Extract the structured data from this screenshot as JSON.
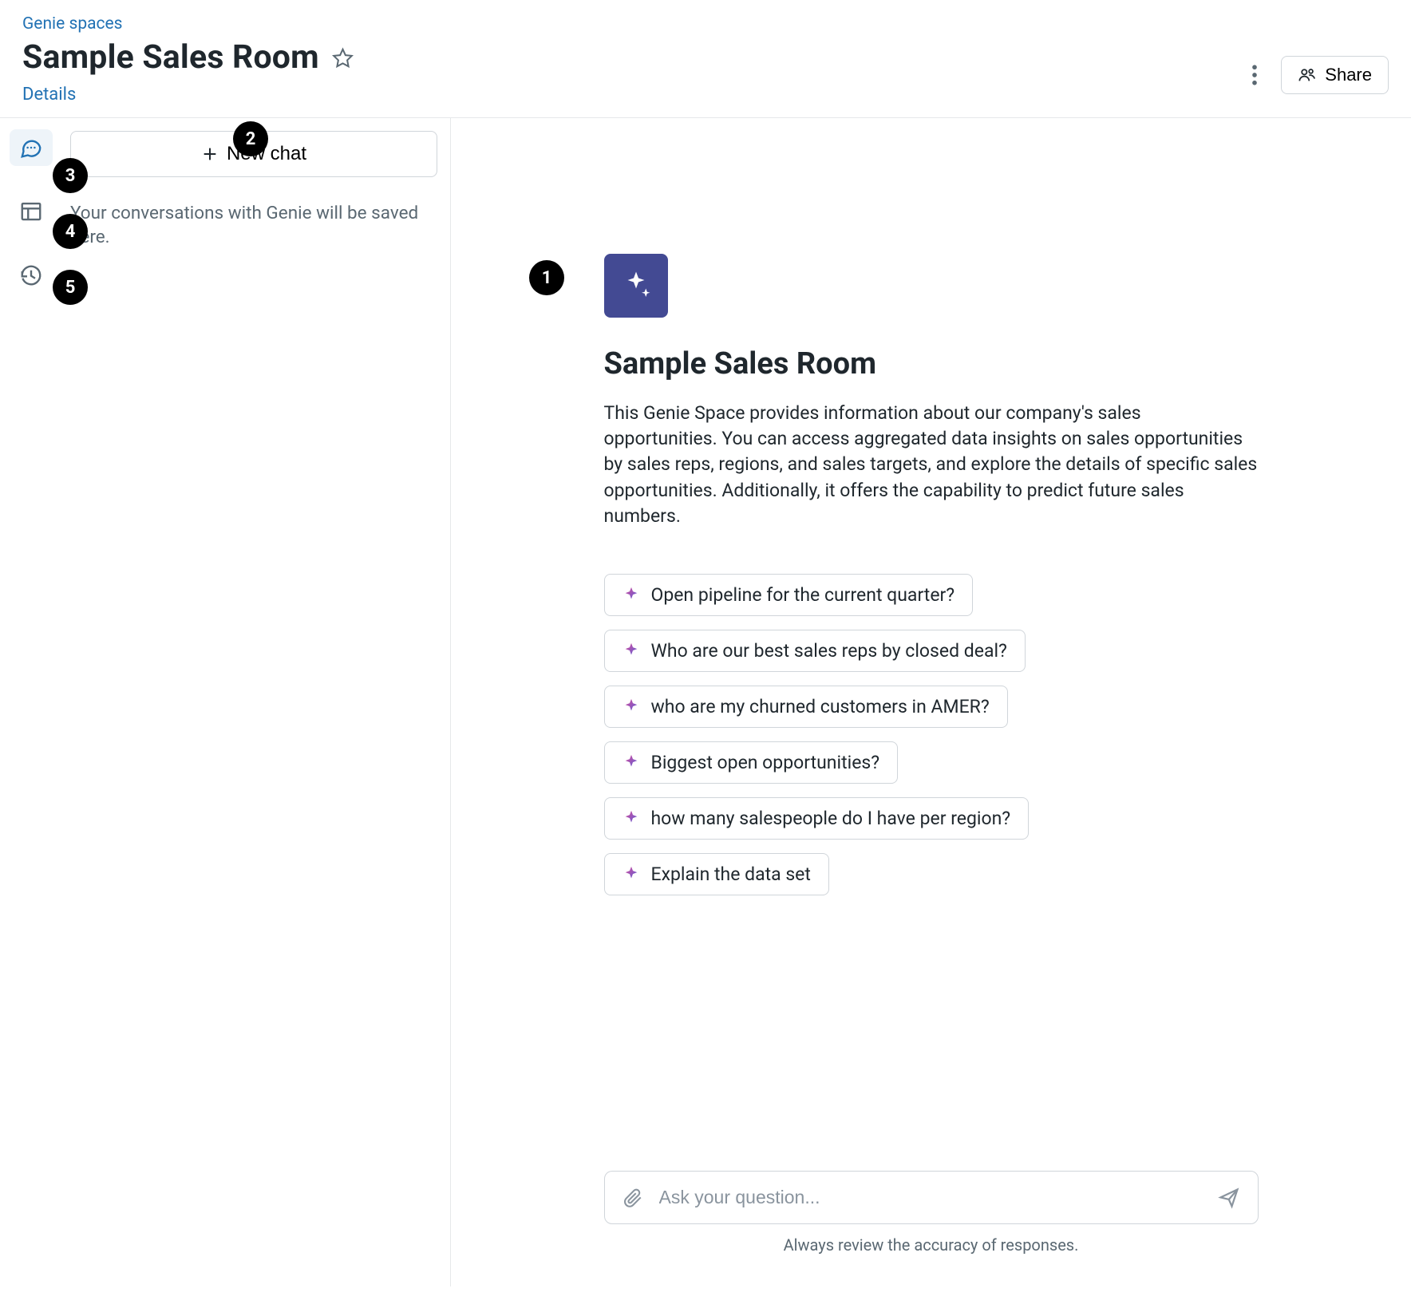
{
  "header": {
    "breadcrumb": "Genie spaces",
    "title": "Sample Sales Room",
    "details_link": "Details",
    "share_label": "Share"
  },
  "side": {
    "new_chat_label": "New chat",
    "empty_note": "Your conversations with Genie will be saved here."
  },
  "nav": {
    "chat_icon": "chat-icon",
    "data_icon": "data-icon",
    "history_icon": "history-icon"
  },
  "main": {
    "title": "Sample Sales Room",
    "description": "This Genie Space provides information about our company's sales opportunities. You can access aggregated data insights on sales opportunities by sales reps, regions, and sales targets, and explore the details of specific sales opportunities. Additionally, it offers the capability to predict future sales numbers.",
    "prompts": [
      "Open pipeline for the current quarter?",
      "Who are our best sales reps by closed deal?",
      "who are my churned customers in AMER?",
      "Biggest open opportunities?",
      "how many salespeople do I have per region?",
      "Explain the data set"
    ],
    "input_placeholder": "Ask your question...",
    "footer_note": "Always review the accuracy of responses."
  },
  "callouts": {
    "c1": "1",
    "c2": "2",
    "c3": "3",
    "c4": "4",
    "c5": "5"
  },
  "colors": {
    "accent_tile": "#434a93",
    "link": "#2272b4"
  }
}
